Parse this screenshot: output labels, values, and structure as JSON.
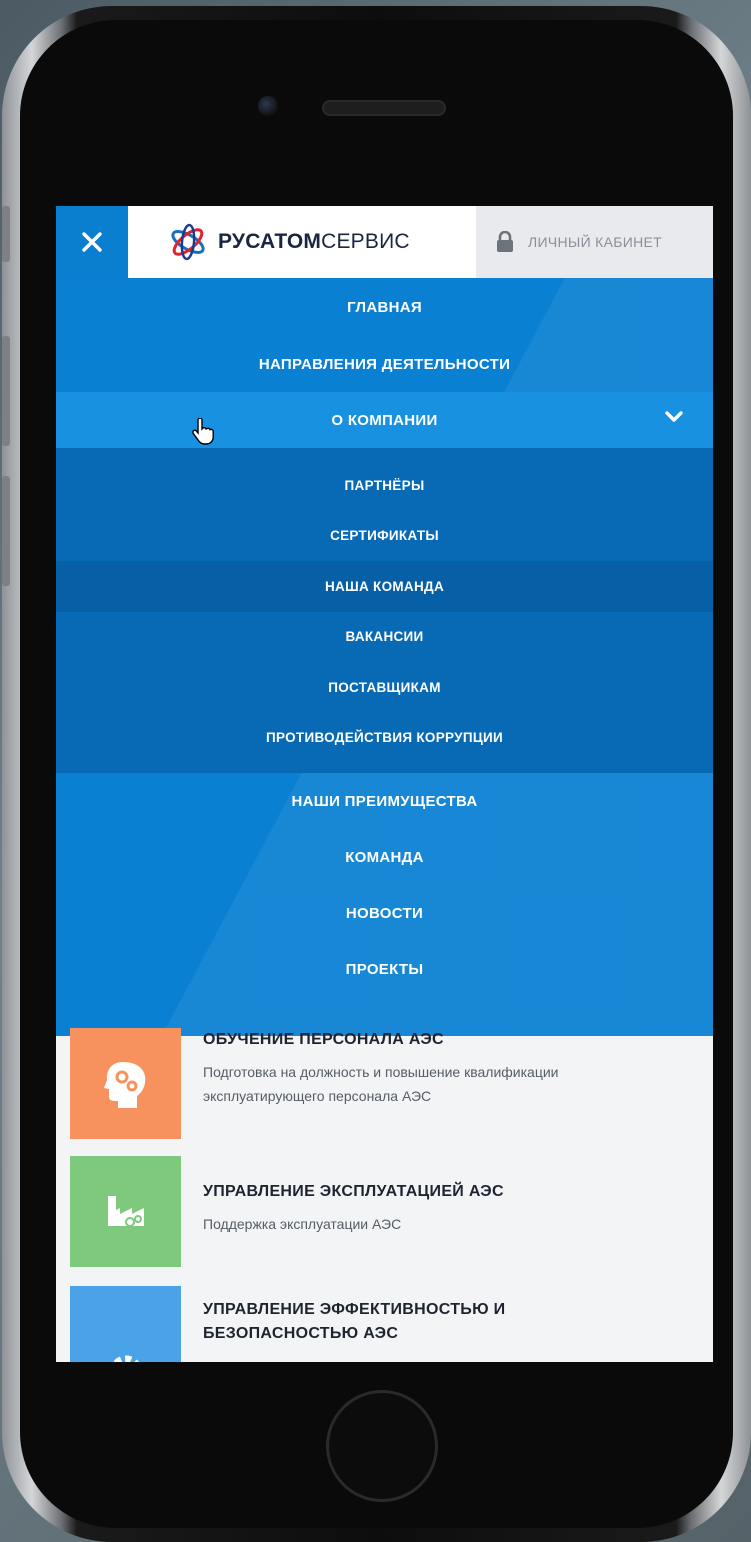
{
  "header": {
    "close_icon": "close-icon",
    "logo_bold": "РУСАТОМ",
    "logo_light": "СЕРВИС",
    "cabinet_label": "ЛИЧНЫЙ КАБИНЕТ",
    "cabinet_icon": "lock-icon"
  },
  "menu": {
    "items_top": [
      "ГЛАВНАЯ",
      "НАПРАВЛЕНИЯ ДЕЯТЕЛЬНОСТИ"
    ],
    "active_item": "О КОМПАНИИ",
    "submenu": [
      "ПАРТНЁРЫ",
      "СЕРТИФИКАТЫ",
      "НАША КОМАНДА",
      "ВАКАНСИИ",
      "ПОСТАВЩИКАМ",
      "ПРОТИВОДЕЙСТВИЯ КОРРУПЦИИ"
    ],
    "items_bottom": [
      "НАШИ ПРЕИМУЩЕСТВА",
      "КОМАНДА",
      "НОВОСТИ",
      "ПРОЕКТЫ"
    ]
  },
  "cards": [
    {
      "title": "ОБУЧЕНИЕ ПЕРСОНАЛА АЭС",
      "desc_line1": "Подготовка на должность и повышение квалификации",
      "desc_line2": "эксплуатирующего персонала АЭС",
      "icon": "head-gears-icon",
      "color": "#f7925f"
    },
    {
      "title": "УПРАВЛЕНИЕ ЭКСПЛУАТАЦИЕЙ АЭС",
      "desc_line1": "Поддержка эксплуатации АЭС",
      "icon": "factory-icon",
      "color": "#7fc97f"
    },
    {
      "title_line1": "УПРАВЛЕНИЕ ЭФФЕКТИВНОСТЬЮ И",
      "title_line2": "БЕЗОПАСНОСТЬЮ АЭС",
      "icon": "gear-wrench-icon",
      "color": "#4aa3e6"
    }
  ],
  "colors": {
    "menu_bg": "#0a80d2",
    "submenu_bg": "#0869b5",
    "active_bg": "#1891e0"
  }
}
